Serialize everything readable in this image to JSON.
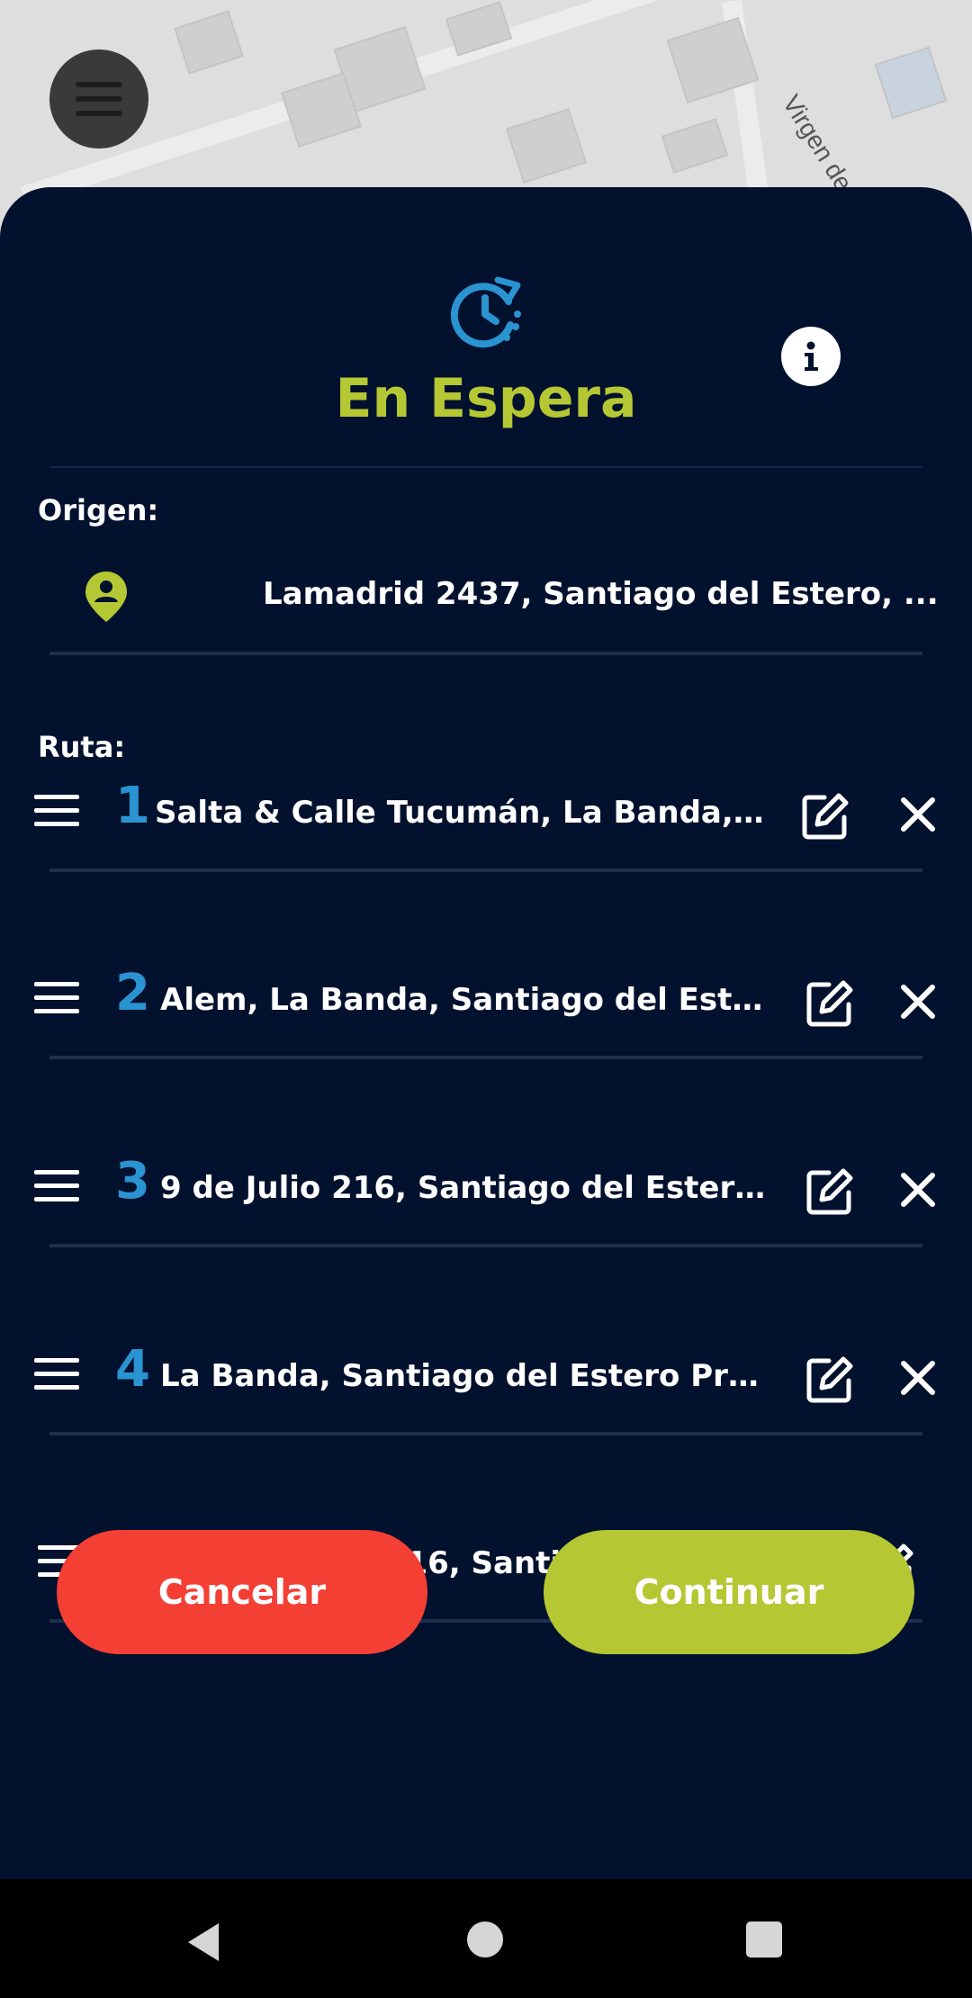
{
  "map": {
    "street_label": "Virgen de"
  },
  "header": {
    "title": "En Espera"
  },
  "origin": {
    "label": "Origen:",
    "address": "Lamadrid 2437, Santiago del Estero, ..."
  },
  "route": {
    "label": "Ruta:",
    "stops": [
      {
        "number": "1",
        "address": "Salta & Calle Tucumán, La Banda, ..."
      },
      {
        "number": "2",
        "address": "Alem, La Banda, Santiago del Estero ..."
      },
      {
        "number": "3",
        "address": "9 de Julio 216, Santiago del Estero, ..."
      },
      {
        "number": "4",
        "address": "La Banda, Santiago del Estero Provinc..."
      }
    ],
    "destination": {
      "address": "Pellegrini 216, Santiago del Estero, ..."
    }
  },
  "actions": {
    "cancel_label": "Cancelar",
    "continue_label": "Continuar"
  },
  "colors": {
    "accent": "#b5c733",
    "sheet": "#02112e",
    "number": "#2a93d1",
    "cancel": "#f43f35"
  }
}
